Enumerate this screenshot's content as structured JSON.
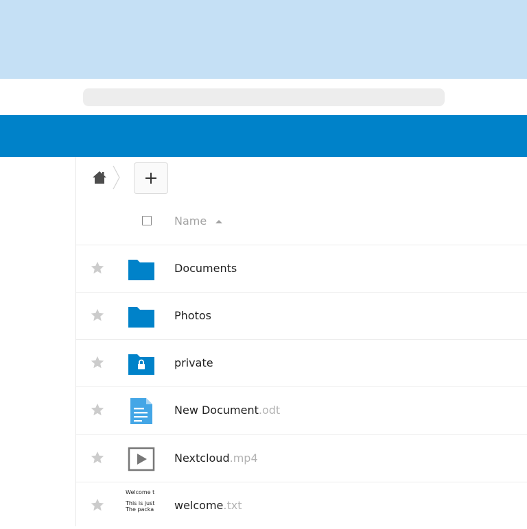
{
  "colors": {
    "banner": "#c5e0f5",
    "header": "#0082c9",
    "folder": "#0082c9",
    "document": "#44a6e6",
    "star": "#cccccc",
    "extension": "#b3b3b3"
  },
  "header": {
    "app_icon": "image-icon"
  },
  "breadcrumb": {
    "home_icon": "home-icon"
  },
  "toolbar": {
    "new_icon": "plus-icon"
  },
  "file_list": {
    "column_name": "Name",
    "sort": "ascending",
    "files": [
      {
        "name": "Documents",
        "ext": "",
        "icon": "folder-icon"
      },
      {
        "name": "Photos",
        "ext": "",
        "icon": "folder-icon"
      },
      {
        "name": "private",
        "ext": "",
        "icon": "locked-folder-icon"
      },
      {
        "name": "New Document",
        "ext": ".odt",
        "icon": "document-icon"
      },
      {
        "name": "Nextcloud",
        "ext": ".mp4",
        "icon": "video-icon"
      },
      {
        "name": "welcome",
        "ext": ".txt",
        "icon": "text-preview",
        "preview_lines": [
          "Welcome t",
          "This is just",
          "The packa"
        ]
      }
    ]
  }
}
